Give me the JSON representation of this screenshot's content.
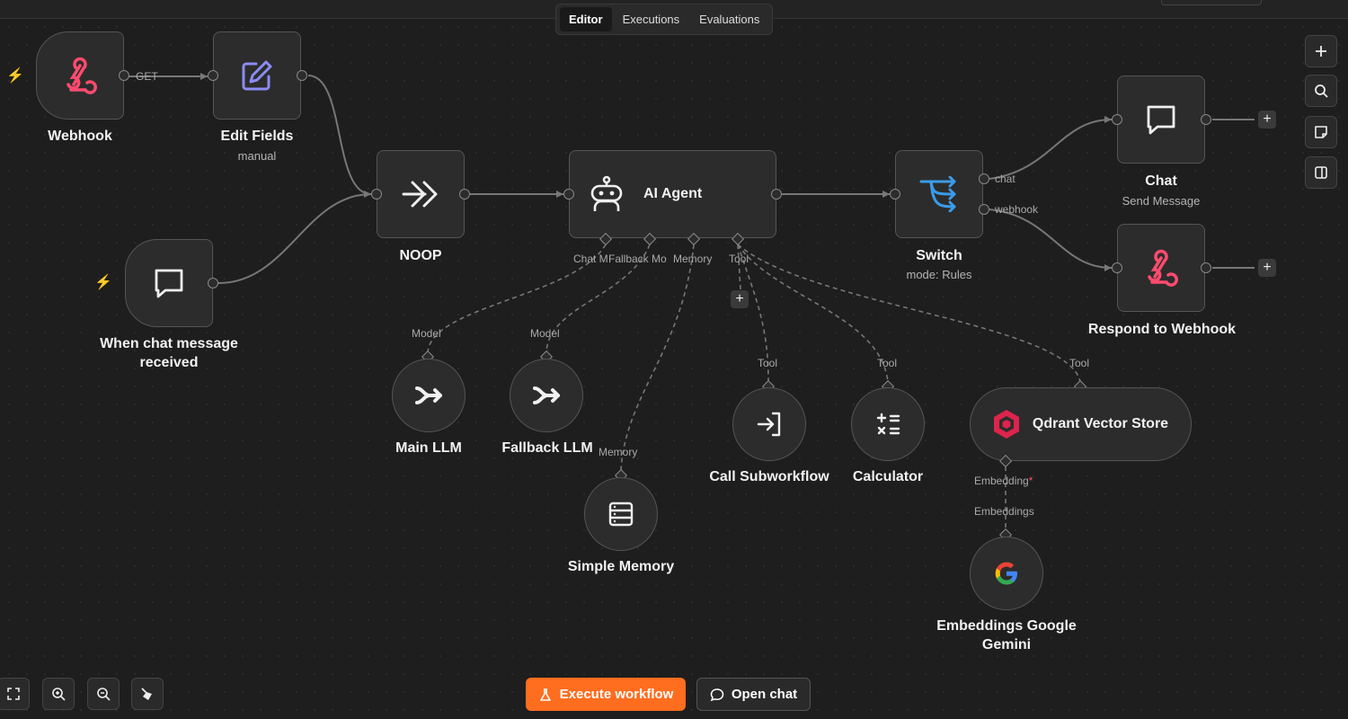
{
  "tabs": [
    {
      "label": "Editor"
    },
    {
      "label": "Executions"
    },
    {
      "label": "Evaluations"
    }
  ],
  "nodes": {
    "webhook": {
      "title": "Webhook"
    },
    "edit_fields": {
      "title": "Edit Fields",
      "subtitle": "manual"
    },
    "chat_trigger": {
      "title_line1": "When chat message",
      "title_line2": "received"
    },
    "noop": {
      "title": "NOOP"
    },
    "ai_agent": {
      "title": "AI Agent"
    },
    "switch": {
      "title": "Switch",
      "subtitle": "mode: Rules"
    },
    "chat": {
      "title": "Chat",
      "subtitle": "Send Message"
    },
    "respond": {
      "title": "Respond to Webhook"
    },
    "main_llm": {
      "title": "Main LLM"
    },
    "fallback_llm": {
      "title": "Fallback LLM"
    },
    "simple_memory": {
      "title": "Simple Memory"
    },
    "call_subworkflow": {
      "title": "Call Subworkflow"
    },
    "calculator": {
      "title": "Calculator"
    },
    "qdrant": {
      "title": "Qdrant Vector Store"
    },
    "gemini": {
      "title_line1": "Embeddings Google",
      "title_line2": "Gemini"
    }
  },
  "edge_labels": {
    "get": "GET",
    "chat": "chat",
    "webhook": "webhook",
    "chat_model": "Chat M",
    "fallback_model": "Fallback Mo",
    "memory": "Memory",
    "tool": "Tool",
    "model": "Model",
    "embedding": "Embedding",
    "required_mark": "*",
    "embeddings": "Embeddings"
  },
  "buttons": {
    "execute": "Execute workflow",
    "open_chat": "Open chat",
    "plus": "+"
  },
  "colors": {
    "accent": "#ff6d1f",
    "webhook": "#ff4b6e",
    "edit": "#8b8cf5",
    "switch": "#3b9be8",
    "qdrant": "#dc244c"
  }
}
